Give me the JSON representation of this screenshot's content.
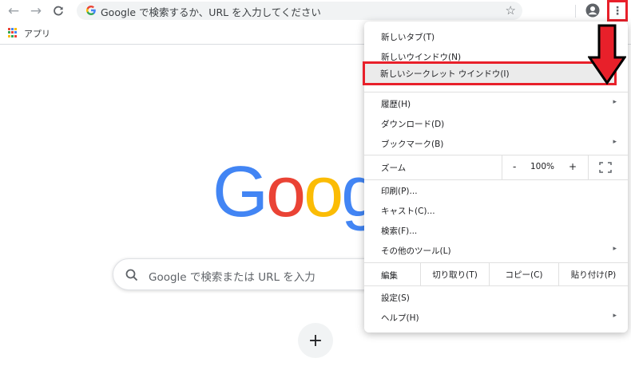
{
  "toolbar": {
    "back_glyph": "←",
    "forward_glyph": "→",
    "reload_glyph": "C",
    "omnibox_placeholder": "Google で検索するか、URL を入力してください",
    "star_glyph": "☆",
    "menu_glyph": "⋮"
  },
  "bookmarks": {
    "apps_label": "アプリ"
  },
  "newtab": {
    "logo_letters": [
      "G",
      "o",
      "o",
      "g"
    ],
    "logo_colors": [
      "#4285F4",
      "#EA4335",
      "#FBBC05",
      "#4285F4"
    ],
    "search_placeholder": "Google で検索または URL を入力",
    "add_shortcut_glyph": "+"
  },
  "menu": {
    "items": [
      {
        "label": "新しいタブ(T)"
      },
      {
        "label": "新しいウインドウ(N)"
      },
      {
        "label": "新しいシークレット ウインドウ(I)"
      },
      {
        "label": "履歴(H)",
        "submenu": "▸"
      },
      {
        "label": "ダウンロード(D)"
      },
      {
        "label": "ブックマーク(B)",
        "submenu": "▸"
      },
      {
        "label": "印刷(P)..."
      },
      {
        "label": "キャスト(C)..."
      },
      {
        "label": "検索(F)..."
      },
      {
        "label": "その他のツール(L)",
        "submenu": "▸"
      },
      {
        "label": "設定(S)"
      },
      {
        "label": "ヘルプ(H)",
        "submenu": "▸"
      }
    ],
    "zoom": {
      "label": "ズーム",
      "minus": "-",
      "value": "100%",
      "plus": "+"
    },
    "edit": {
      "label": "編集",
      "cut": "切り取り(T)",
      "copy": "コピー(C)",
      "paste": "貼り付け(P)"
    }
  },
  "colors": {
    "annotation_red": "#e8202a",
    "highlight_bg": "#ebebeb"
  },
  "icons": [
    "back-arrow-icon",
    "forward-arrow-icon",
    "reload-icon",
    "google-g-icon",
    "star-icon",
    "profile-icon",
    "kebab-menu-icon",
    "apps-grid-icon",
    "search-icon",
    "plus-icon",
    "fullscreen-icon",
    "chevron-right-icon",
    "down-arrow-annotation-icon"
  ]
}
